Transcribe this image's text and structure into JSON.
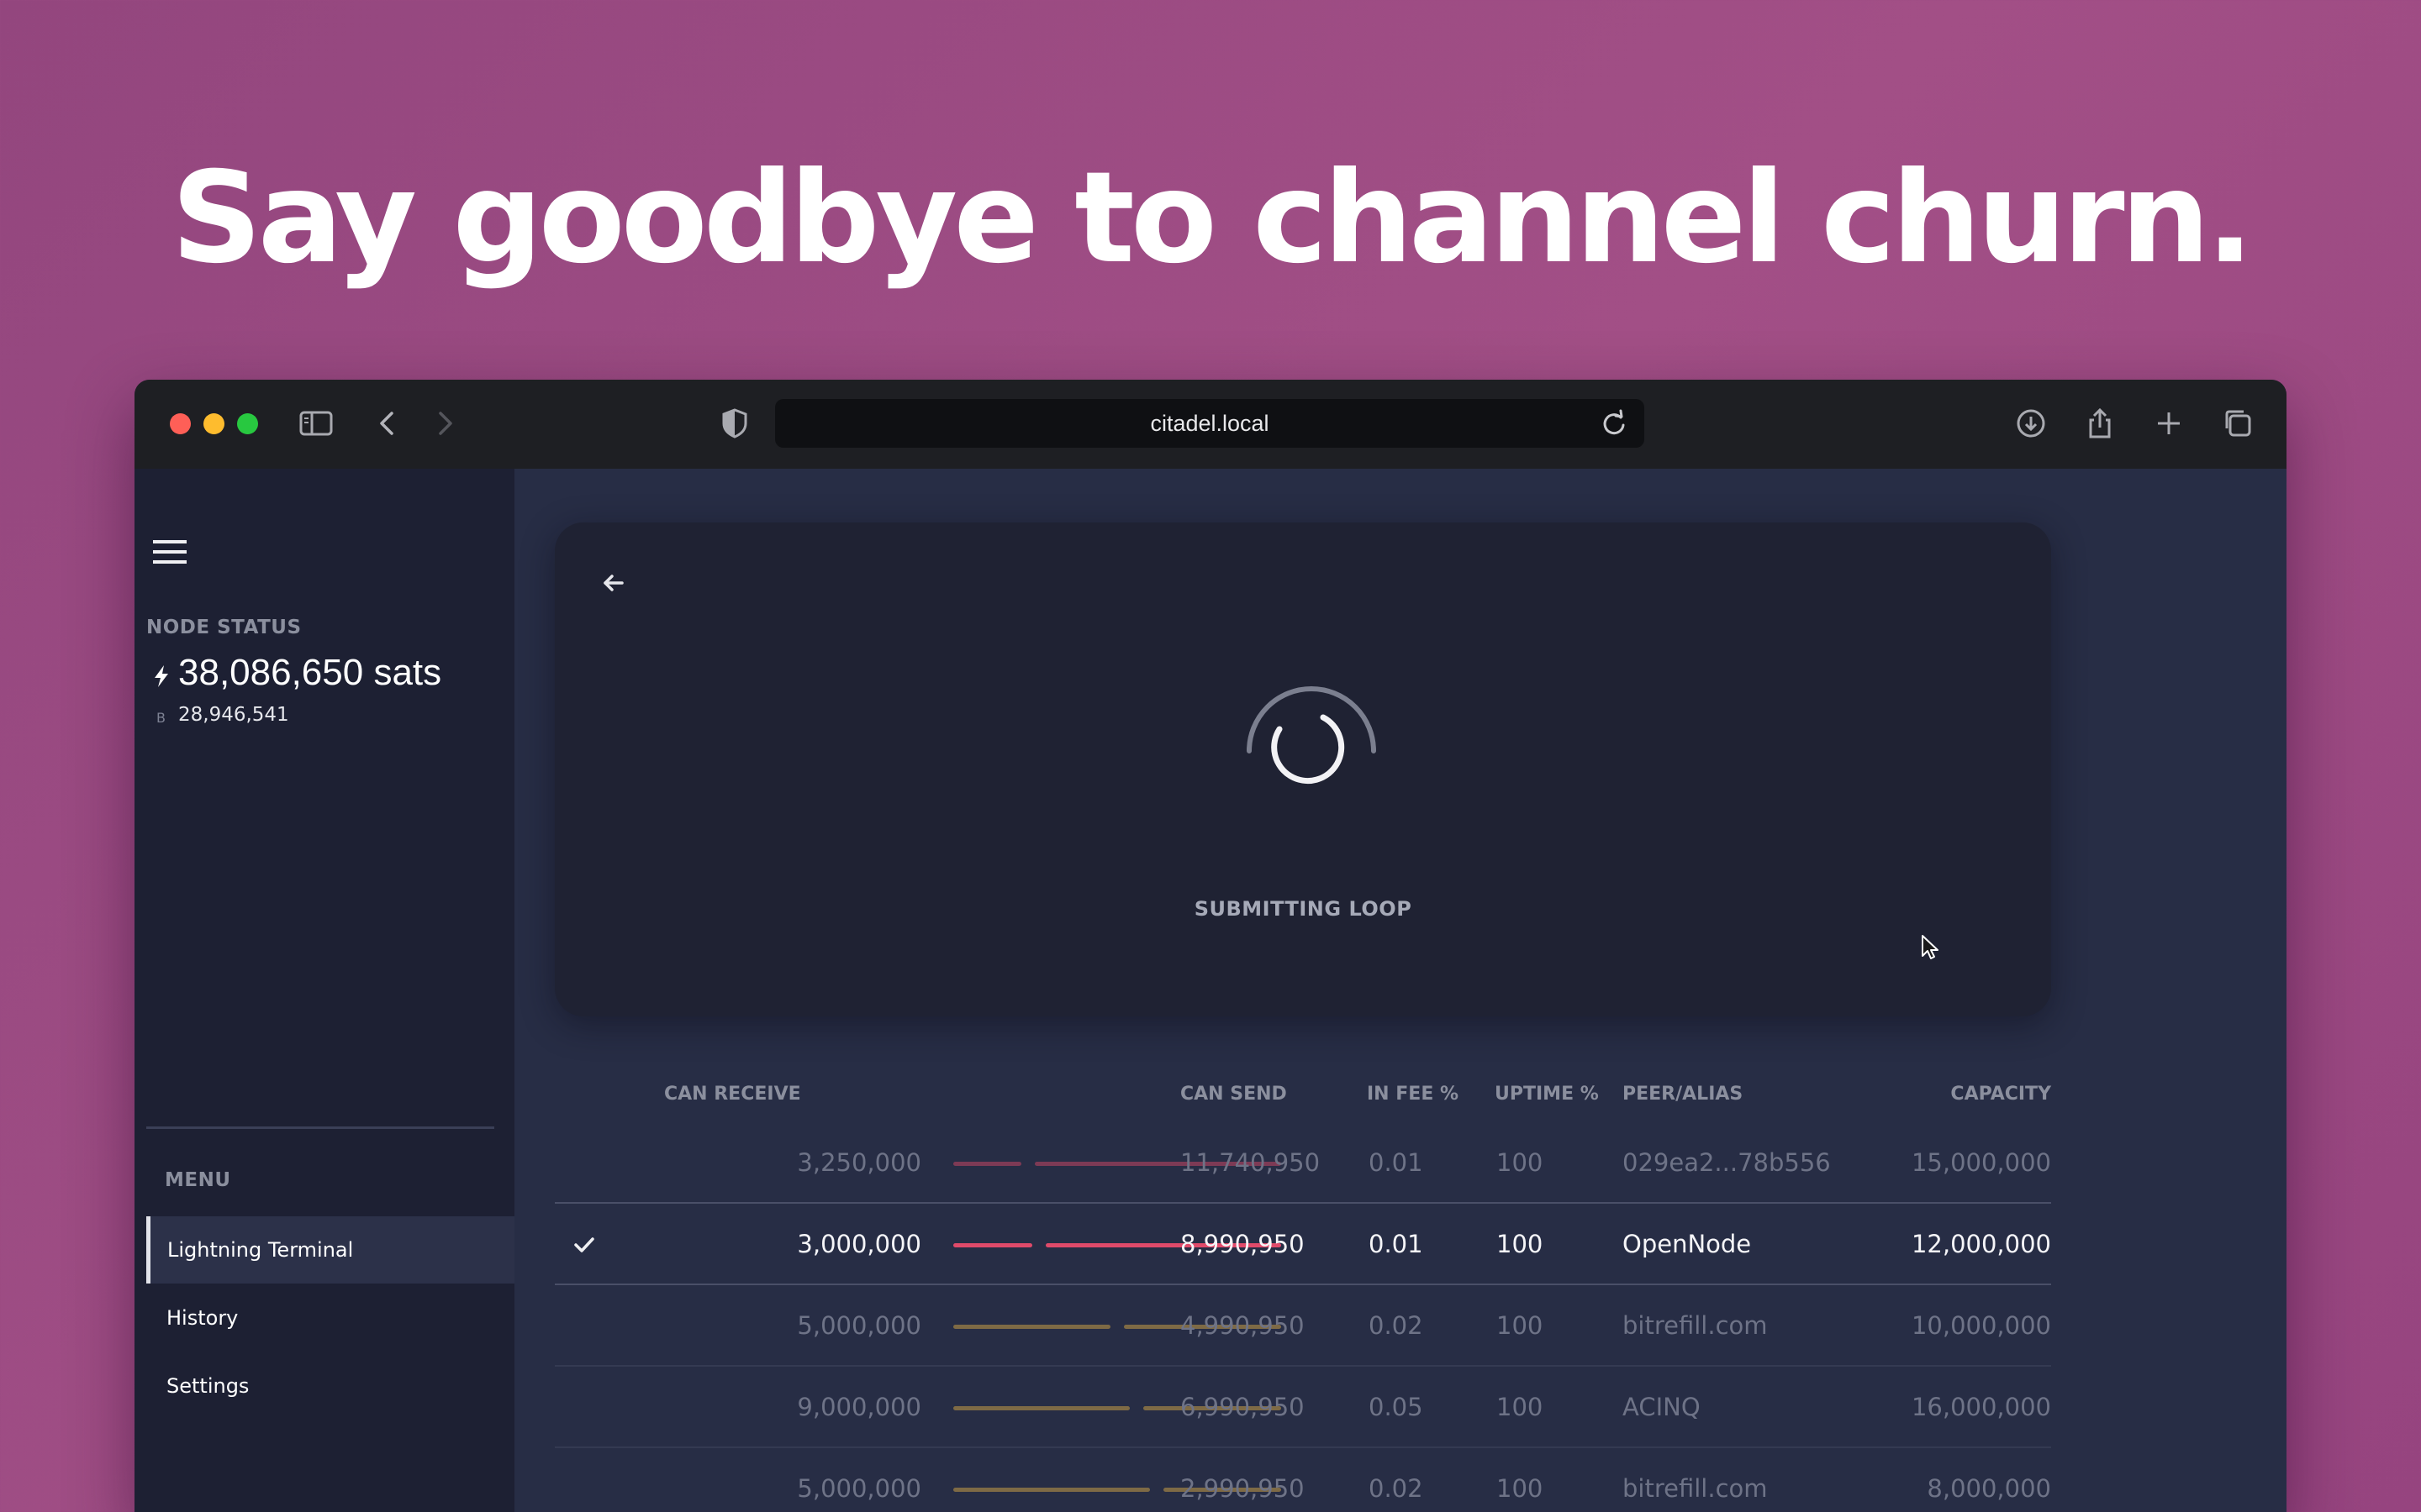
{
  "headline": "Say goodbye to channel churn.",
  "browser": {
    "url": "citadel.local"
  },
  "sidebar": {
    "node_status_label": "NODE STATUS",
    "sats_balance": "38,086,650 sats",
    "btc_balance": "28,946,541",
    "menu_label": "MENU",
    "items": [
      {
        "label": "Lightning Terminal",
        "active": true
      },
      {
        "label": "History",
        "active": false
      },
      {
        "label": "Settings",
        "active": false
      }
    ]
  },
  "loop_card": {
    "status_text": "SUBMITTING LOOP"
  },
  "channels_table": {
    "headers": {
      "can_receive": "CAN RECEIVE",
      "can_send": "CAN SEND",
      "in_fee": "IN FEE %",
      "uptime": "UPTIME %",
      "peer": "PEER/ALIAS",
      "capacity": "CAPACITY"
    },
    "rows": [
      {
        "selected": false,
        "can_receive": "3,250,000",
        "can_send": "11,740,950",
        "in_fee": "0.01",
        "uptime": "100",
        "peer": "029ea2...78b556",
        "capacity": "15,000,000",
        "bar_color": "#7d3a55",
        "receive_fraction": 0.217
      },
      {
        "selected": true,
        "can_receive": "3,000,000",
        "can_send": "8,990,950",
        "in_fee": "0.01",
        "uptime": "100",
        "peer": "OpenNode",
        "capacity": "12,000,000",
        "bar_color": "#e04a6a",
        "receive_fraction": 0.25
      },
      {
        "selected": false,
        "can_receive": "5,000,000",
        "can_send": "4,990,950",
        "in_fee": "0.02",
        "uptime": "100",
        "peer": "bitrefill.com",
        "capacity": "10,000,000",
        "bar_color": "#7e6a45",
        "receive_fraction": 0.5
      },
      {
        "selected": false,
        "can_receive": "9,000,000",
        "can_send": "6,990,950",
        "in_fee": "0.05",
        "uptime": "100",
        "peer": "ACINQ",
        "capacity": "16,000,000",
        "bar_color": "#7e6a45",
        "receive_fraction": 0.5625
      },
      {
        "selected": false,
        "can_receive": "5,000,000",
        "can_send": "2,990,950",
        "in_fee": "0.02",
        "uptime": "100",
        "peer": "bitrefill.com",
        "capacity": "8,000,000",
        "bar_color": "#7e6a45",
        "receive_fraction": 0.625
      }
    ]
  },
  "colors": {
    "background": "#9a4882",
    "sidebar": "#1d2033",
    "content": "#272d45",
    "card": "#1f2233",
    "accent_pink": "#e04a6a"
  }
}
